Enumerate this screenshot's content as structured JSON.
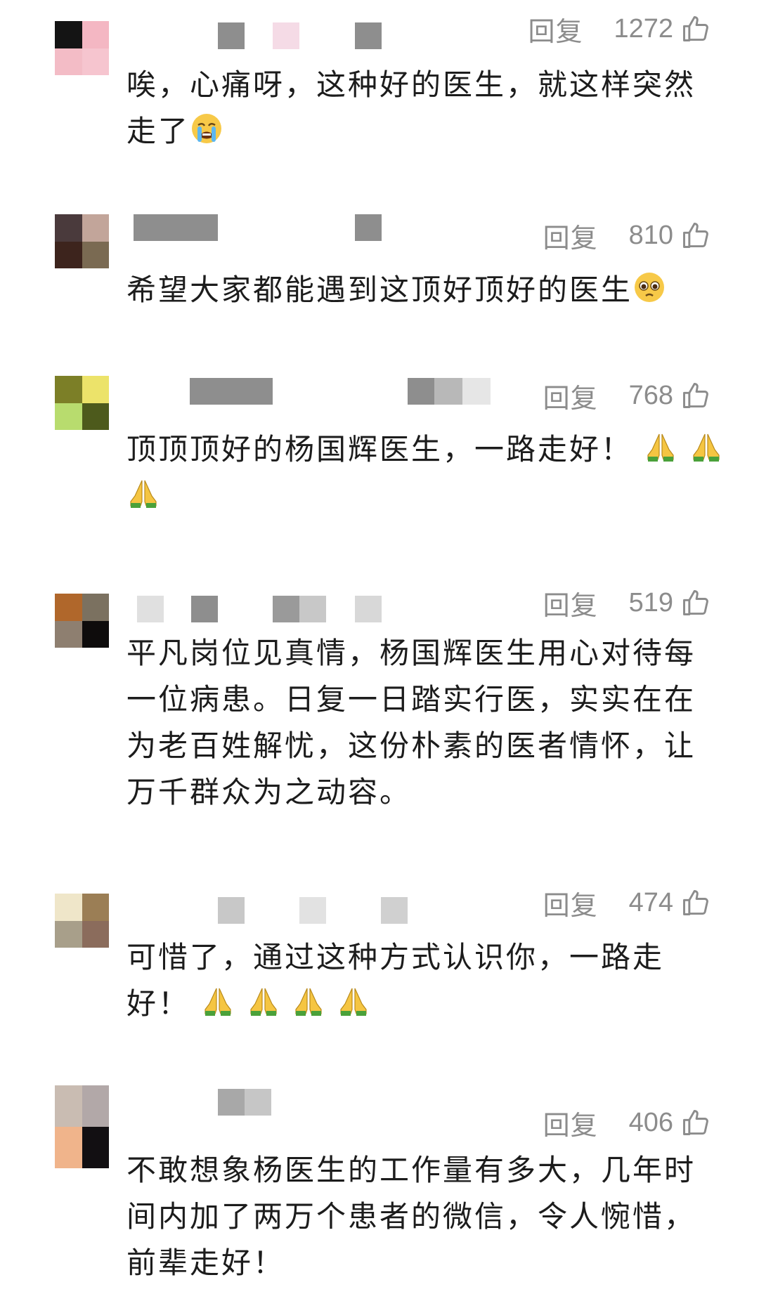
{
  "ui": {
    "reply_label": "回复",
    "like_icon": "thumbs-up-icon"
  },
  "comments": [
    {
      "likes": "1272",
      "text": "唉，心痛呀，这种好的医生，就这样突然走了",
      "emojis": [
        "crying-face"
      ],
      "avatar_colors": [
        "#141414",
        "#f4b7c3",
        "#f3bcc6",
        "#f6c5cf"
      ]
    },
    {
      "likes": "810",
      "text": "希望大家都能遇到这顶好顶好的医生",
      "emojis": [
        "pleading-face"
      ],
      "avatar_colors": [
        "#4a3a3c",
        "#c2a59a",
        "#3d241d",
        "#7a6a52"
      ]
    },
    {
      "likes": "768",
      "text": "顶顶顶好的杨国辉医生，一路走好！",
      "emojis": [
        "folded-hands",
        "folded-hands",
        "folded-hands"
      ],
      "avatar_colors": [
        "#7c7f27",
        "#ece36a",
        "#b8dc6e",
        "#4d5a1c"
      ]
    },
    {
      "likes": "519",
      "text": "平凡岗位见真情，杨国辉医生用心对待每一位病患。日复一日踏实行医，实实在在为老百姓解忧，这份朴素的医者情怀，让万千群众为之动容。",
      "emojis": [],
      "avatar_colors": [
        "#b0672b",
        "#7b7160",
        "#8e7f70",
        "#0e0c0c"
      ]
    },
    {
      "likes": "474",
      "text": "可惜了，通过这种方式认识你，一路走好！",
      "emojis": [
        "folded-hands",
        "folded-hands",
        "folded-hands",
        "folded-hands"
      ],
      "avatar_colors": [
        "#efe6c9",
        "#9b7e55",
        "#a89f8a",
        "#8b6c5c"
      ]
    },
    {
      "likes": "406",
      "text": "不敢想象杨医生的工作量有多大，几年时间内加了两万个患者的微信，令人惋惜，前辈走好！",
      "emojis": [],
      "avatar_colors": [
        "#c9bcb2",
        "#b2a8a8",
        "#f0b48b",
        "#120f12"
      ]
    }
  ]
}
